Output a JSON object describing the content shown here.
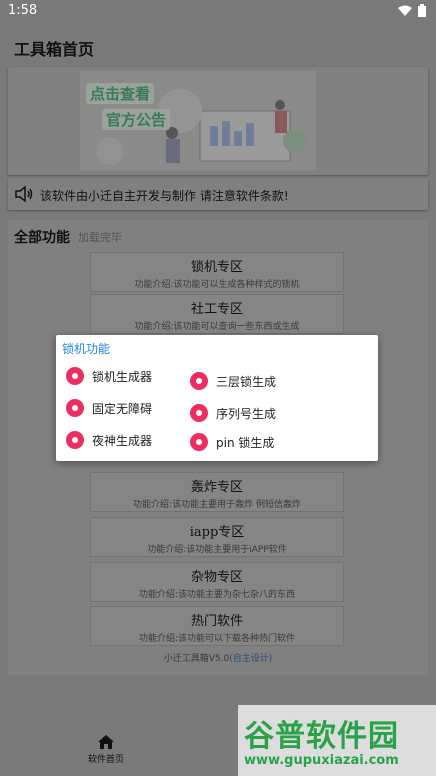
{
  "status_bar": {
    "time": "1:58"
  },
  "app": {
    "title": "工具箱首页"
  },
  "banner": {
    "line1": "点击查看",
    "line2": "官方公告"
  },
  "notice": {
    "text": "该软件由小迁自主开发与制作 请注意软件条款!"
  },
  "section": {
    "title": "全部功能",
    "status": "加载完毕"
  },
  "features": [
    {
      "name": "锁机专区",
      "desc": "功能介绍:该功能可以生成各种样式的锁机"
    },
    {
      "name": "社工专区",
      "desc": "功能介绍:该功能可以查询一些东西或生成"
    },
    {
      "name": "轰炸专区",
      "desc": "功能介绍:该功能主要用于轰炸 例短信轰炸"
    },
    {
      "name": "iapp专区",
      "desc": "功能介绍:该功能主要用于iAPP软件"
    },
    {
      "name": "杂物专区",
      "desc": "功能介绍:该功能主要为杂七杂八的东西"
    },
    {
      "name": "热门软件",
      "desc": "功能介绍:该功能可以下载各种热门软件"
    }
  ],
  "footer": {
    "text": "小迁工具箱V5.0",
    "link": "(自主设计)"
  },
  "nav": {
    "home_label": "软件首页"
  },
  "watermark": {
    "big": "谷普软件园",
    "small": "www.gupuxiazai.com"
  },
  "dialog": {
    "title": "锁机功能",
    "options": [
      "锁机生成器",
      "三层锁生成",
      "固定无障碍",
      "序列号生成",
      "夜神生成器",
      "pin 锁生成"
    ]
  },
  "colors": {
    "accent": "#ec2d5f",
    "dialog_title": "#1e88e5",
    "watermark": "#2aa24a"
  }
}
